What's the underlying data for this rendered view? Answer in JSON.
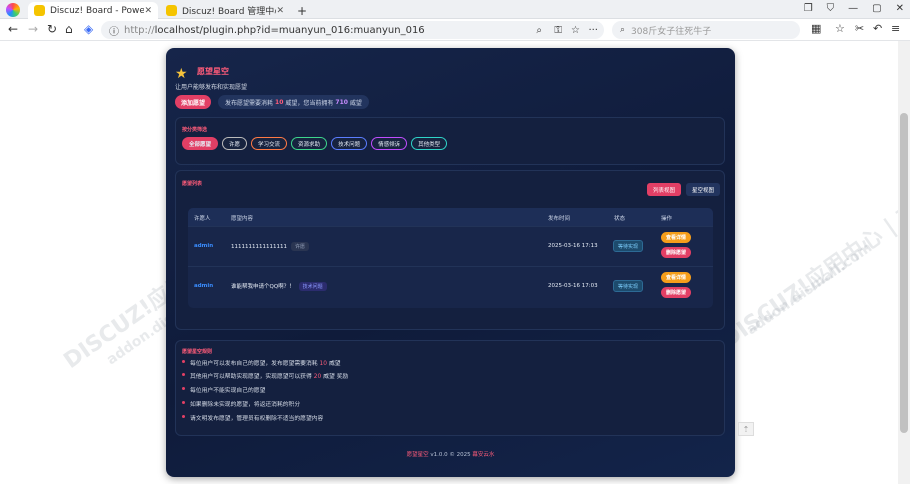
{
  "browser": {
    "tabs": [
      {
        "label": "Discuz! Board - Powered b",
        "active": true
      },
      {
        "label": "Discuz! Board 管理中心 - 插",
        "active": false
      }
    ],
    "new_tab": "+",
    "url_prefix": "http://",
    "url_rest": "localhost/plugin.php?id=muanyun_016:muanyun_016",
    "search_placeholder": "308斤女子往死牛子"
  },
  "plugin": {
    "title": "愿望星空",
    "subtitle": "让用户能够发布和实现愿望",
    "add_button": "添加愿望",
    "cost_text_1": "发布愿望需要消耗",
    "cost_value": "10",
    "cost_text_2": "威望，您当前拥有",
    "balance_value": "710",
    "cost_text_3": "威望",
    "filter_title": "按分类筛选",
    "filters": [
      "全部愿望",
      "许愿",
      "学习交流",
      "资源求助",
      "技术问题",
      "情感倾诉",
      "其他类型"
    ],
    "list_title": "愿望列表",
    "view_list": "列表视图",
    "view_star": "星空视图",
    "columns": [
      "许愿人",
      "愿望内容",
      "发布时间",
      "状态",
      "操作"
    ],
    "rows": [
      {
        "user": "admin",
        "content": "1111111111111111",
        "tag": "许愿",
        "time": "2025-03-16 17:13",
        "status": "等待实现",
        "help": "查看详情",
        "delete": "删除愿望"
      },
      {
        "user": "admin",
        "content": "谁能帮我申请个QQ啊？！",
        "tag": "技术问题",
        "time": "2025-03-16 17:03",
        "status": "等待实现",
        "help": "查看详情",
        "delete": "删除愿望"
      }
    ],
    "rules_title": "愿望星空规则",
    "rules": [
      {
        "a": "每位用户可以发布自己的愿望，发布愿望需要消耗",
        "n": "10",
        "b": "威望"
      },
      {
        "a": "其他用户可以帮助实现愿望，实现愿望可以获得",
        "n": "20",
        "b": "威望 奖励"
      },
      {
        "a": "每位用户不能实现自己的愿望",
        "n": "",
        "b": ""
      },
      {
        "a": "如果删除未实现的愿望，将返还消耗的积分",
        "n": "",
        "b": ""
      },
      {
        "a": "请文明发布愿望，管理员有权删除不适当的愿望内容",
        "n": "",
        "b": ""
      }
    ],
    "footer_brand": "愿望星空",
    "footer_version": "v1.0.0 © 2025",
    "footer_author": "幕安云水"
  },
  "watermark": {
    "left_1": "DISCUZ!应用中心",
    "left_2": "addon.dismall.com",
    "right_1": "DISCUZ!应用中心 | 贰道",
    "right_2": "addon.dismall.com"
  },
  "colors": {
    "accent": "#e23f65",
    "card_bg": "#0f1b3a",
    "link": "#3a8dff"
  }
}
